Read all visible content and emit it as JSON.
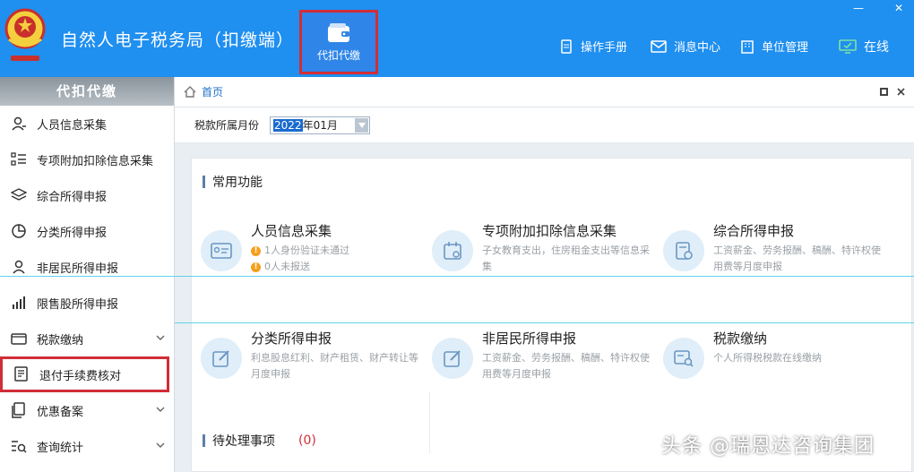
{
  "header": {
    "app_title": "自然人电子税务局（扣缴端）",
    "module_button": "代扣代缴",
    "links": {
      "manual": "操作手册",
      "messages": "消息中心",
      "unit_manage": "单位管理",
      "online": "在线"
    },
    "window_controls": {
      "minimize": "—",
      "close": "✕"
    }
  },
  "sidebar": {
    "title": "代扣代缴",
    "items": [
      {
        "label": "人员信息采集"
      },
      {
        "label": "专项附加扣除信息采集"
      },
      {
        "label": "综合所得申报"
      },
      {
        "label": "分类所得申报"
      },
      {
        "label": "非居民所得申报"
      },
      {
        "label": "限售股所得申报"
      },
      {
        "label": "税款缴纳"
      },
      {
        "label": "退付手续费核对"
      },
      {
        "label": "优惠备案"
      },
      {
        "label": "查询统计"
      }
    ]
  },
  "breadcrumb": {
    "home": "首页"
  },
  "filter": {
    "label": "税款所属月份",
    "month_year": "2022",
    "month_rest": "年01月"
  },
  "common_functions": {
    "title": "常用功能",
    "cards": [
      {
        "title": "人员信息采集",
        "warn1": "1人身份验证未通过",
        "warn2": "0人未报送"
      },
      {
        "title": "专项附加扣除信息采集",
        "desc": "子女教育支出，住房租金支出等信息采集"
      },
      {
        "title": "综合所得申报",
        "desc": "工资薪金、劳务报酬、稿酬、特许权使用费等月度申报"
      },
      {
        "title": "分类所得申报",
        "desc": "利息股息红利、财产租赁、财产转让等月度申报"
      },
      {
        "title": "非居民所得申报",
        "desc": "工资薪金、劳务报酬、稿酬、特许权使用费等月度申报"
      },
      {
        "title": "税款缴纳",
        "desc": "个人所得税税款在线缴纳"
      }
    ]
  },
  "pending": {
    "title": "待处理事项",
    "count": "(0)"
  },
  "watermark": "头条 @瑞恩达咨询集团",
  "colors": {
    "header_blue": "#1f8ff0",
    "highlight_red": "#d12d37",
    "warn_orange": "#f4a01c"
  }
}
